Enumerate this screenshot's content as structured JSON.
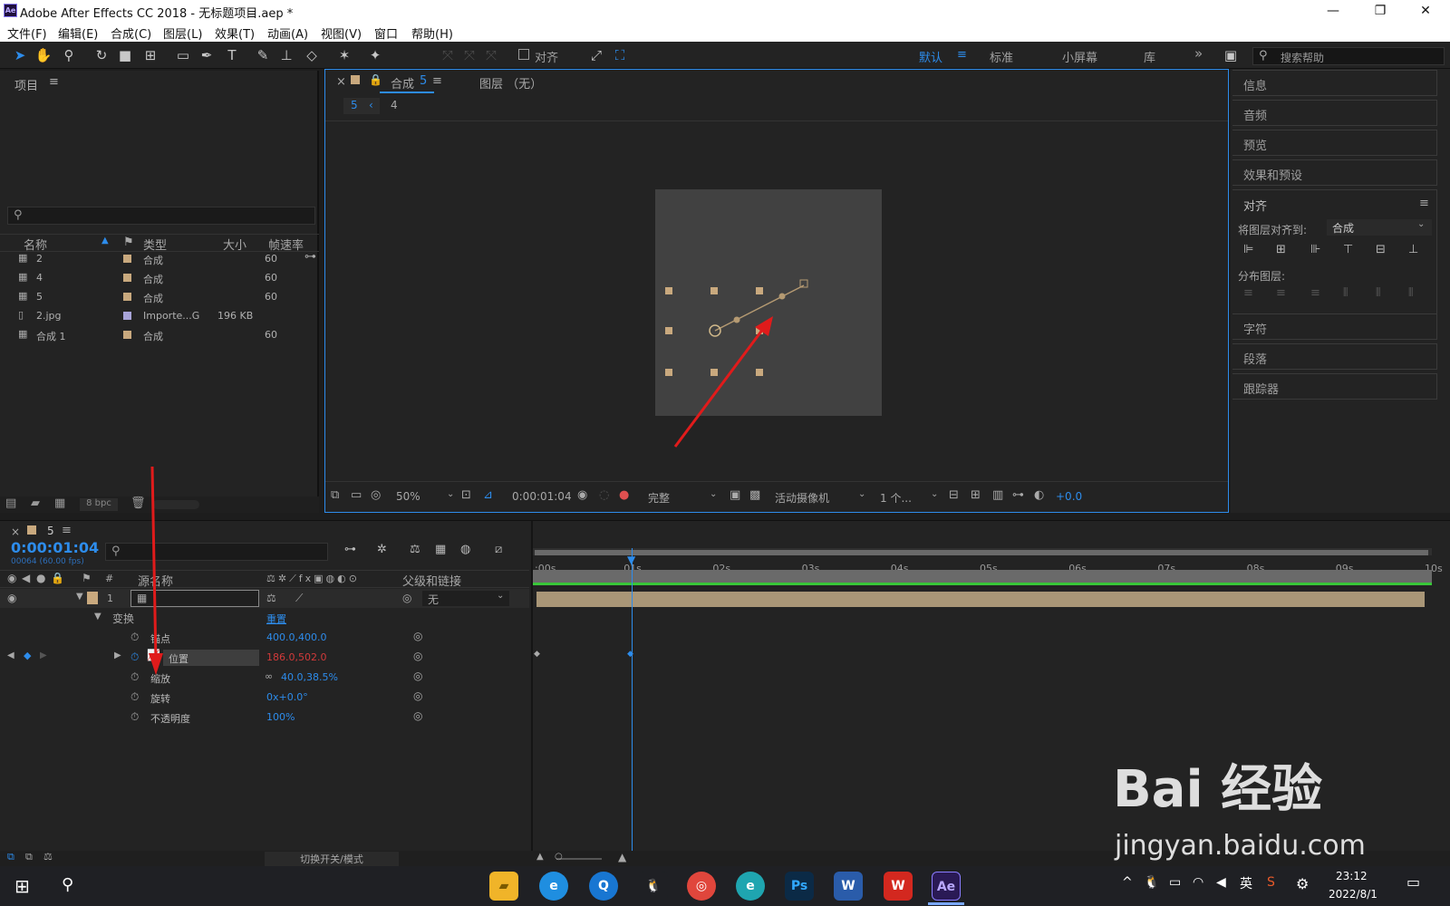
{
  "window": {
    "title": "Adobe After Effects CC 2018 - 无标题项目.aep *",
    "logo": "Ae",
    "minimize": "—",
    "restore": "❐",
    "close": "✕"
  },
  "menu": [
    "文件(F)",
    "编辑(E)",
    "合成(C)",
    "图层(L)",
    "效果(T)",
    "动画(A)",
    "视图(V)",
    "窗口",
    "帮助(H)"
  ],
  "toolbar": {
    "align_label": "对齐",
    "workspaces": [
      "默认",
      "标准",
      "小屏幕",
      "库"
    ],
    "more": "»",
    "search_placeholder": "搜索帮助"
  },
  "project": {
    "title": "项目",
    "columns": [
      "名称",
      "类型",
      "大小",
      "帧速率"
    ],
    "items": [
      {
        "name": "2",
        "type": "合成",
        "size": "",
        "fps": "60",
        "color": "#c9a97e"
      },
      {
        "name": "4",
        "type": "合成",
        "size": "",
        "fps": "60",
        "color": "#c9a97e"
      },
      {
        "name": "5",
        "type": "合成",
        "size": "",
        "fps": "60",
        "color": "#c9a97e"
      },
      {
        "name": "2.jpg",
        "type": "Importe...G",
        "size": "196 KB",
        "fps": "",
        "color": "#a8a4d8"
      },
      {
        "name": "合成 1",
        "type": "合成",
        "size": "",
        "fps": "60",
        "color": "#c9a97e"
      }
    ],
    "bpc": "8 bpc"
  },
  "composition": {
    "tab_label": "合成",
    "tab_num": "5",
    "layer_tab": "图层 （无）",
    "breadcrumb": [
      "5",
      "4"
    ],
    "zoom": "50%",
    "timecode": "0:00:01:04",
    "quality": "完整",
    "camera": "活动摄像机",
    "views": "1 个...",
    "exposure": "+0.0"
  },
  "right_panels": [
    "信息",
    "音频",
    "预览",
    "效果和预设"
  ],
  "align": {
    "title": "对齐",
    "align_to_label": "将图层对齐到:",
    "align_to_value": "合成",
    "distribute_label": "分布图层:"
  },
  "right_panels2": [
    "字符",
    "段落",
    "跟踪器"
  ],
  "timeline": {
    "comp_name": "5",
    "timecode": "0:00:01:04",
    "frames": "00064 (60.00 fps)",
    "col_source": "源名称",
    "col_parent": "父级和链接",
    "layer_num": "1",
    "parent_value": "无",
    "transform": "变换",
    "reset": "重置",
    "properties": [
      {
        "name": "锚点",
        "value": "400.0,400.0"
      },
      {
        "name": "位置",
        "value": "186.0,502.0"
      },
      {
        "name": "缩放",
        "value": "40.0,38.5%"
      },
      {
        "name": "旋转",
        "value": "0x+0.0°"
      },
      {
        "name": "不透明度",
        "value": "100%"
      }
    ],
    "ruler": [
      ":00s",
      "01s",
      "02s",
      "03s",
      "04s",
      "05s",
      "06s",
      "07s",
      "08s",
      "09s",
      "10s"
    ],
    "toggle_label": "切换开关/模式"
  },
  "taskbar": {
    "time": "23:12",
    "date": "2022/8/1",
    "ime": "英"
  },
  "watermark": {
    "logo": "Bai 经验",
    "url": "jingyan.baidu.com"
  }
}
